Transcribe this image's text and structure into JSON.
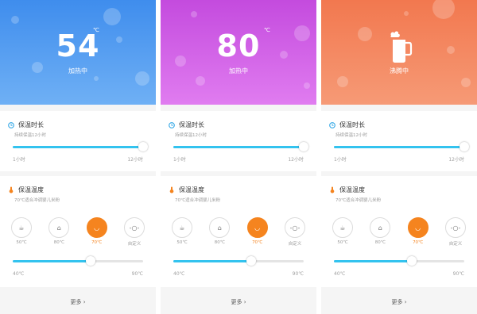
{
  "screens": [
    {
      "hero": {
        "temperature": "54",
        "unit": "℃",
        "status": "加热中",
        "color": "#4a97ef"
      },
      "keep_warm": {
        "title": "保温时长",
        "subtitle": "持续保温12小时",
        "min_label": "1小时",
        "max_label": "12小时",
        "value_fraction": 1.0
      },
      "keep_temp": {
        "title": "保温温度",
        "subtitle": "70℃适合冲调婴儿米粉",
        "min_label": "40℃",
        "max_label": "90℃",
        "value_fraction": 0.6,
        "presets": [
          {
            "label": "50℃",
            "icon": "cup-icon",
            "active": false
          },
          {
            "label": "80℃",
            "icon": "teapot-icon",
            "active": false
          },
          {
            "label": "70℃",
            "icon": "bowl-icon",
            "active": true
          },
          {
            "label": "自定义",
            "icon": "custom-icon",
            "active": false
          }
        ]
      },
      "more_label": "更多"
    },
    {
      "hero": {
        "temperature": "80",
        "unit": "℃",
        "status": "加热中",
        "color": "#d05fe7"
      },
      "keep_warm": {
        "title": "保温时长",
        "subtitle": "持续保温12小时",
        "min_label": "1小时",
        "max_label": "12小时",
        "value_fraction": 1.0
      },
      "keep_temp": {
        "title": "保温温度",
        "subtitle": "70℃适合冲调婴儿米粉",
        "min_label": "40℃",
        "max_label": "90℃",
        "value_fraction": 0.6,
        "presets": [
          {
            "label": "50℃",
            "icon": "cup-icon",
            "active": false
          },
          {
            "label": "80℃",
            "icon": "teapot-icon",
            "active": false
          },
          {
            "label": "70℃",
            "icon": "bowl-icon",
            "active": true
          },
          {
            "label": "自定义",
            "icon": "custom-icon",
            "active": false
          }
        ]
      },
      "more_label": "更多"
    },
    {
      "hero": {
        "temperature": "",
        "unit": "",
        "status": "沸腾中",
        "color": "#f4845b"
      },
      "keep_warm": {
        "title": "保温时长",
        "subtitle": "持续保温12小时",
        "min_label": "1小时",
        "max_label": "12小时",
        "value_fraction": 1.0
      },
      "keep_temp": {
        "title": "保温温度",
        "subtitle": "70℃适合冲调婴儿米粉",
        "min_label": "40℃",
        "max_label": "90℃",
        "value_fraction": 0.6,
        "presets": [
          {
            "label": "50℃",
            "icon": "cup-icon",
            "active": false
          },
          {
            "label": "80℃",
            "icon": "teapot-icon",
            "active": false
          },
          {
            "label": "70℃",
            "icon": "bowl-icon",
            "active": true
          },
          {
            "label": "自定义",
            "icon": "custom-icon",
            "active": false
          }
        ]
      },
      "more_label": "更多"
    }
  ]
}
